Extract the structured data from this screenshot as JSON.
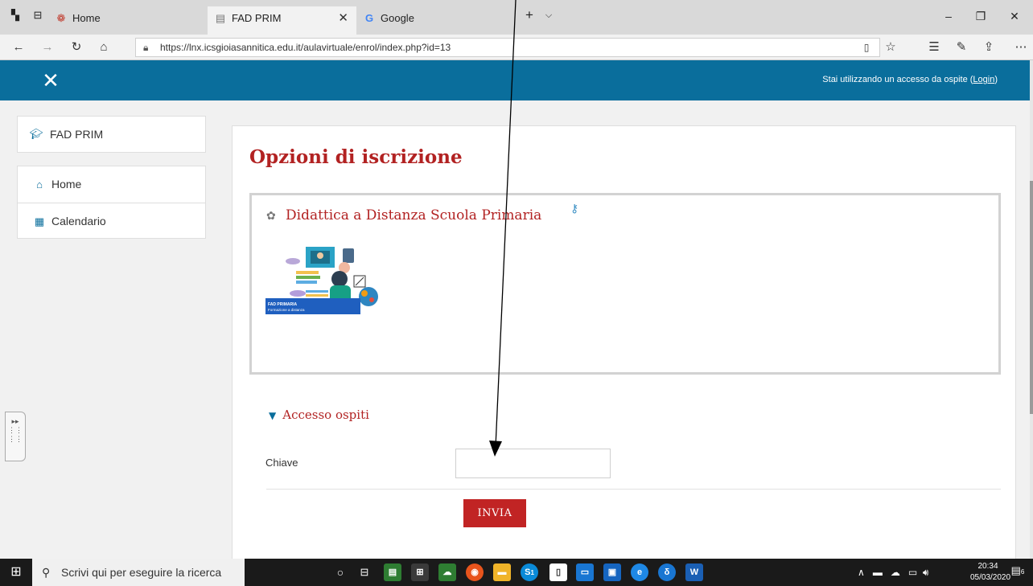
{
  "browser": {
    "tabs": [
      {
        "label": "Home",
        "active": false
      },
      {
        "label": "FAD PRIM",
        "active": true
      },
      {
        "label": "Google",
        "active": false
      }
    ],
    "url": "https://lnx.icsgioiasannitica.edu.it/aulavirtuale/enrol/index.php?id=13"
  },
  "site_header": {
    "guest_text": "Stai utilizzando un accesso da ospite (",
    "login_link": "Login",
    "guest_text_end": ")"
  },
  "nav_drawer": {
    "course_item": "FAD PRIM",
    "items": [
      {
        "label": "Home"
      },
      {
        "label": "Calendario"
      }
    ]
  },
  "main": {
    "page_title": "Opzioni di iscrizione",
    "course": {
      "name": "Didattica a Distanza Scuola Primaria",
      "image_caption_line1": "FAD PRIMARIA",
      "image_caption_line2": "Formazione a distanza"
    },
    "section": {
      "title": "Accesso ospiti",
      "key_label": "Chiave",
      "key_value": "",
      "submit_label": "INVIA"
    }
  },
  "taskbar": {
    "search_placeholder": "Scrivi qui per eseguire la ricerca",
    "clock_time": "20:34",
    "clock_date": "05/03/2020",
    "notification_count": "6",
    "skype_badge": "1"
  },
  "colors": {
    "header_blue": "#0a6e9c",
    "title_red": "#b22222",
    "button_red": "#c12424"
  }
}
